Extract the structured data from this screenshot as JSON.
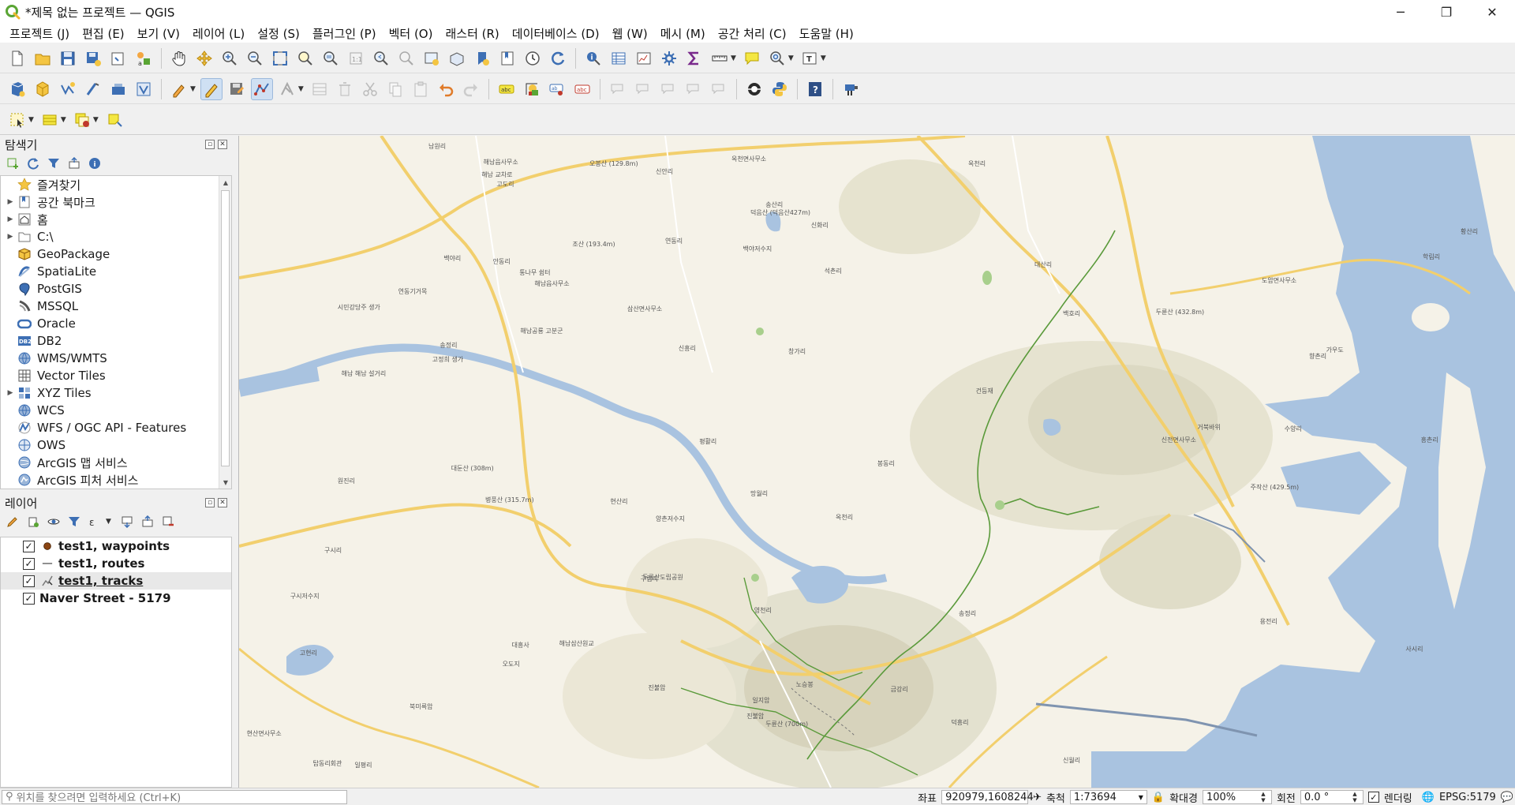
{
  "window": {
    "title": "*제목 없는 프로젝트 — QGIS",
    "controls": {
      "minimize": "─",
      "maximize": "❐",
      "close": "✕"
    }
  },
  "menubar": [
    "프로젝트 (J)",
    "편집 (E)",
    "보기 (V)",
    "레이어 (L)",
    "설정 (S)",
    "플러그인 (P)",
    "벡터 (O)",
    "래스터 (R)",
    "데이터베이스 (D)",
    "웹 (W)",
    "메시 (M)",
    "공간 처리 (C)",
    "도움말 (H)"
  ],
  "browser": {
    "title": "탐색기",
    "items": [
      {
        "label": "즐겨찾기",
        "icon": "star-icon",
        "expandable": false
      },
      {
        "label": "공간 북마크",
        "icon": "bookmark-icon",
        "expandable": true
      },
      {
        "label": "홈",
        "icon": "home-icon",
        "expandable": true
      },
      {
        "label": "C:\\",
        "icon": "folder-icon",
        "expandable": true
      },
      {
        "label": "GeoPackage",
        "icon": "geopackage-icon",
        "expandable": false
      },
      {
        "label": "SpatiaLite",
        "icon": "spatialite-icon",
        "expandable": false
      },
      {
        "label": "PostGIS",
        "icon": "postgis-icon",
        "expandable": false
      },
      {
        "label": "MSSQL",
        "icon": "mssql-icon",
        "expandable": false
      },
      {
        "label": "Oracle",
        "icon": "oracle-icon",
        "expandable": false
      },
      {
        "label": "DB2",
        "icon": "db2-icon",
        "expandable": false
      },
      {
        "label": "WMS/WMTS",
        "icon": "wms-icon",
        "expandable": false
      },
      {
        "label": "Vector Tiles",
        "icon": "vector-tiles-icon",
        "expandable": false
      },
      {
        "label": "XYZ Tiles",
        "icon": "xyz-tiles-icon",
        "expandable": true
      },
      {
        "label": "WCS",
        "icon": "wcs-icon",
        "expandable": false
      },
      {
        "label": "WFS / OGC API - Features",
        "icon": "wfs-icon",
        "expandable": false
      },
      {
        "label": "OWS",
        "icon": "ows-icon",
        "expandable": false
      },
      {
        "label": "ArcGIS 맵 서비스",
        "icon": "arcgis-map-icon",
        "expandable": false
      },
      {
        "label": "ArcGIS 피처 서비스",
        "icon": "arcgis-feature-icon",
        "expandable": false
      }
    ]
  },
  "layers": {
    "title": "레이어",
    "items": [
      {
        "label": "test1, waypoints",
        "checked": "✓",
        "symbol": "point"
      },
      {
        "label": "test1, routes",
        "checked": "✓",
        "symbol": "line"
      },
      {
        "label": "test1, tracks",
        "checked": "✓",
        "symbol": "track"
      },
      {
        "label": "Naver Street - 5179",
        "checked": "✓",
        "symbol": "none"
      }
    ]
  },
  "status": {
    "locator_placeholder": "위치를 찾으려면 입력하세요 (Ctrl+K)",
    "coord_label": "좌표",
    "coord_value": "920979,1608244",
    "scale_label": "축척",
    "scale_value": "1:73694",
    "magnifier_label": "확대경",
    "magnifier_value": "100%",
    "rotation_label": "회전",
    "rotation_value": "0.0 °",
    "render_label": "렌더링",
    "render_checked": "✓",
    "crs": "EPSG:5179"
  },
  "map_labels": [
    "남원리",
    "해남읍사무소",
    "오봉산 (129.8m)",
    "신안리",
    "옥천면사무소",
    "옥천리",
    "고도리",
    "해남 교차로",
    "덕음산 (덕음산427m)",
    "송산리",
    "신화리",
    "연동리",
    "조산 (193.4m)",
    "백야저수지",
    "대산리",
    "황산리",
    "백야리",
    "안동리",
    "해남읍사무소",
    "통나무 쉼터",
    "석촌리",
    "학림리",
    "시민강당주 생가",
    "연동기거목",
    "삼산면사무소",
    "백호리",
    "두륜산 (432.8m)",
    "도암면사무소",
    "해남공룡 고분군",
    "송정리",
    "창가리",
    "향촌리",
    "가우도",
    "고정희 생가",
    "신흥리",
    "건등재",
    "수양리",
    "해남 해남 설거리",
    "거북바위",
    "신전면사무소",
    "평활리",
    "봉동리",
    "대둔산 (308m)",
    "원진리",
    "흥촌리",
    "주작산 (429.5m)",
    "병풍산 (315.7m)",
    "양촌저수지",
    "현산리",
    "옥천리",
    "구시리",
    "구시저수지",
    "망월리",
    "구림리",
    "두륜산도립공원",
    "영천리",
    "오도지",
    "대흥사",
    "북미륵암",
    "송정리",
    "용전리",
    "사시리",
    "고현리",
    "진불암",
    "일지암",
    "노승봉",
    "진불암",
    "두륜산 (700m)",
    "금강리",
    "덕흥리",
    "신월리",
    "현산면사무소",
    "탑동리회관",
    "일평리",
    "해남삼산원교"
  ]
}
